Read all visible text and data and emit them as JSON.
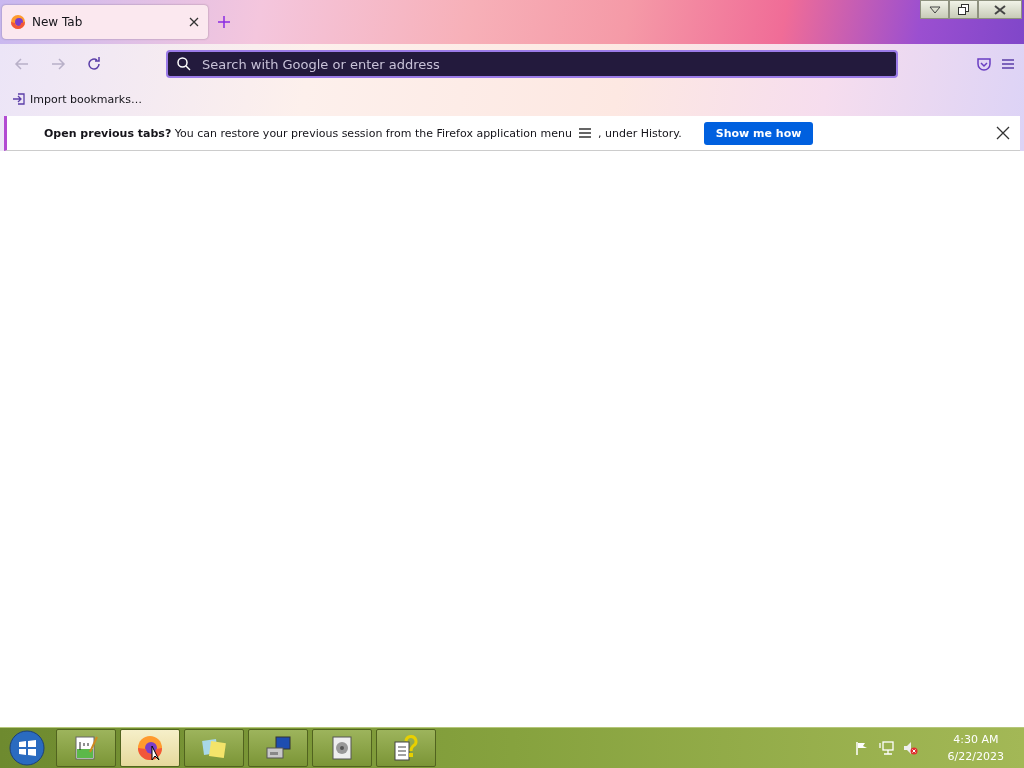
{
  "tabs": [
    {
      "title": "New Tab",
      "selected": true
    }
  ],
  "address_bar": {
    "placeholder": "Search with Google or enter address"
  },
  "bookmarks_bar": {
    "items": [
      "Import bookmarks…"
    ]
  },
  "notification": {
    "message": "**Open previous tabs?** You can restore your previous session from the Firefox application menu",
    "message_end": ", under History.",
    "button": "Show me how"
  },
  "taskbar": {
    "apps": [
      {
        "kind": "notepad",
        "selected": false
      },
      {
        "kind": "firefox",
        "selected": true
      },
      {
        "kind": "notes",
        "selected": false
      },
      {
        "kind": "computer",
        "selected": false
      },
      {
        "kind": "disk",
        "selected": false
      },
      {
        "kind": "help",
        "selected": false
      }
    ],
    "clock": {
      "time": "4:30 AM",
      "date": "6/22/2023"
    }
  }
}
